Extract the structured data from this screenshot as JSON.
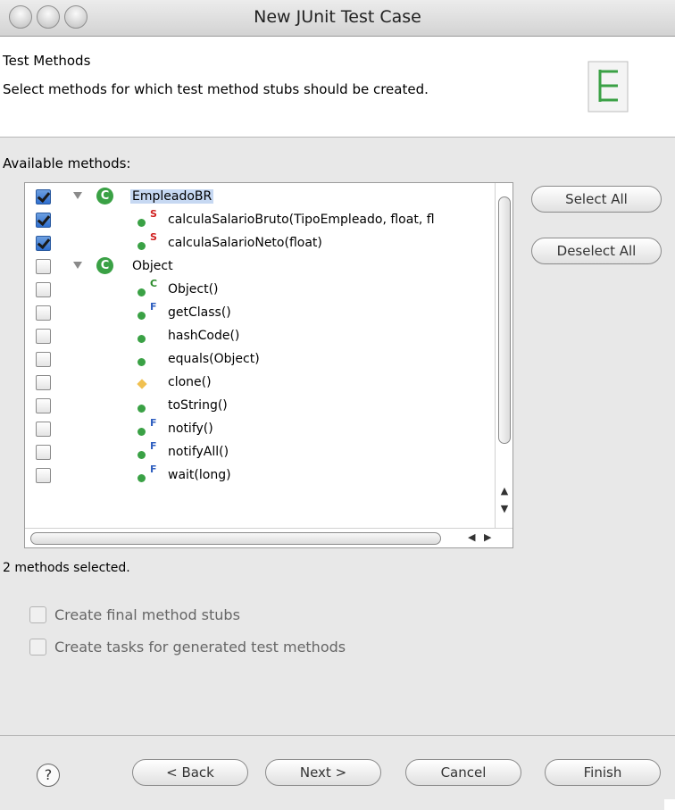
{
  "window": {
    "title": "New JUnit Test Case"
  },
  "header": {
    "title": "Test Methods",
    "description": "Select methods for which test method stubs should be created.",
    "icon": "test-case-icon"
  },
  "tree": {
    "label": "Available methods:",
    "rows": [
      {
        "kind": "class",
        "label": "EmpleadoBR",
        "checked": true,
        "selected": true
      },
      {
        "kind": "method",
        "modifier": "S",
        "label": "calculaSalarioBruto(TipoEmpleado, float, fl",
        "checked": true
      },
      {
        "kind": "method",
        "modifier": "S",
        "label": "calculaSalarioNeto(float)",
        "checked": true
      },
      {
        "kind": "class",
        "label": "Object",
        "checked": false
      },
      {
        "kind": "method",
        "modifier": "C",
        "label": "Object()",
        "checked": false
      },
      {
        "kind": "method",
        "modifier": "F",
        "label": "getClass()",
        "checked": false
      },
      {
        "kind": "method",
        "modifier": "",
        "label": "hashCode()",
        "checked": false
      },
      {
        "kind": "method",
        "modifier": "",
        "label": "equals(Object)",
        "checked": false
      },
      {
        "kind": "protected",
        "modifier": "",
        "label": "clone()",
        "checked": false
      },
      {
        "kind": "method",
        "modifier": "",
        "label": "toString()",
        "checked": false
      },
      {
        "kind": "method",
        "modifier": "F",
        "label": "notify()",
        "checked": false
      },
      {
        "kind": "method",
        "modifier": "F",
        "label": "notifyAll()",
        "checked": false
      },
      {
        "kind": "method",
        "modifier": "F",
        "label": "wait(long)",
        "checked": false
      }
    ]
  },
  "buttons": {
    "select_all": "Select All",
    "deselect_all": "Deselect All",
    "back": "< Back",
    "next": "Next >",
    "cancel": "Cancel",
    "finish": "Finish",
    "help": "?"
  },
  "status": "2 methods selected.",
  "options": [
    {
      "label": "Create final method stubs",
      "checked": false
    },
    {
      "label": "Create tasks for generated test methods",
      "checked": false
    }
  ],
  "colors": {
    "accent": "#3aa145",
    "selection": "#c6d8f2",
    "static_modifier": "#d02020",
    "final_modifier": "#3060c0"
  }
}
